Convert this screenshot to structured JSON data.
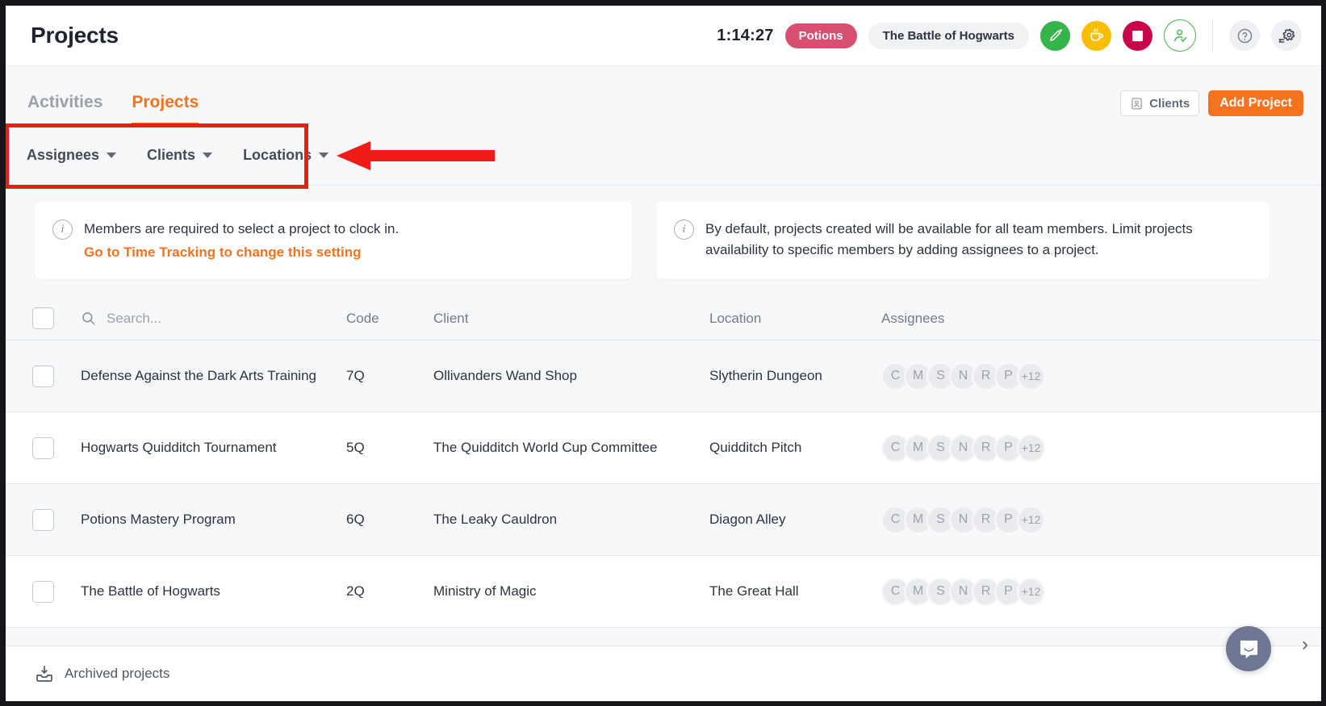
{
  "header": {
    "title": "Projects",
    "timer": "1:14:27",
    "activity_badge": "Potions",
    "project_badge": "The Battle of Hogwarts",
    "icons": {
      "start": "pen-timer-icon",
      "break": "coffee-cup-icon",
      "stop": "stop-square-icon",
      "clock_status": "user-check-icon",
      "help": "question-mark-icon",
      "settings": "gear-icon"
    },
    "colors": {
      "accent": "#f5731f",
      "activity_badge": "#d94f72",
      "start": "#34b44a",
      "break": "#fbbc04",
      "stop": "#c8054a",
      "clock_status": "#4caf50"
    }
  },
  "tabs": [
    {
      "label": "Activities",
      "active": false
    },
    {
      "label": "Projects",
      "active": true
    }
  ],
  "toolbar": {
    "clients_label": "Clients",
    "add_project_label": "Add Project"
  },
  "filters": [
    {
      "label": "Assignees"
    },
    {
      "label": "Clients"
    },
    {
      "label": "Locations"
    }
  ],
  "banners": [
    {
      "text": "Members are required to select a project to clock in.",
      "link": "Go to Time Tracking to change this setting"
    },
    {
      "text": "By default, projects created will be available for all team members. Limit projects availability to specific members by adding assignees to a project."
    }
  ],
  "table": {
    "search_placeholder": "Search...",
    "columns": [
      "Code",
      "Client",
      "Location",
      "Assignees"
    ],
    "rows": [
      {
        "name": "Defense Against the Dark Arts Training",
        "code": "7Q",
        "client": "Ollivanders Wand Shop",
        "location": "Slytherin Dungeon",
        "assignees": [
          "C",
          "M",
          "S",
          "N",
          "R",
          "P"
        ],
        "assignees_more": "+12"
      },
      {
        "name": "Hogwarts Quidditch Tournament",
        "code": "5Q",
        "client": "The Quidditch World Cup Committee",
        "location": "Quidditch Pitch",
        "assignees": [
          "C",
          "M",
          "S",
          "N",
          "R",
          "P"
        ],
        "assignees_more": "+12"
      },
      {
        "name": "Potions Mastery Program",
        "code": "6Q",
        "client": "The Leaky Cauldron",
        "location": "Diagon Alley",
        "assignees": [
          "C",
          "M",
          "S",
          "N",
          "R",
          "P"
        ],
        "assignees_more": "+12"
      },
      {
        "name": "The Battle of Hogwarts",
        "code": "2Q",
        "client": "Ministry of Magic",
        "location": "The Great Hall",
        "assignees": [
          "C",
          "M",
          "S",
          "N",
          "R",
          "P"
        ],
        "assignees_more": "+12"
      }
    ]
  },
  "footer": {
    "archived_label": "Archived projects"
  },
  "widgets": {
    "chat": "intercom-chat-icon",
    "chat_chevron": "›"
  },
  "annotation": {
    "color": "#ee1c14",
    "shape": "rectangle-with-left-arrow"
  }
}
